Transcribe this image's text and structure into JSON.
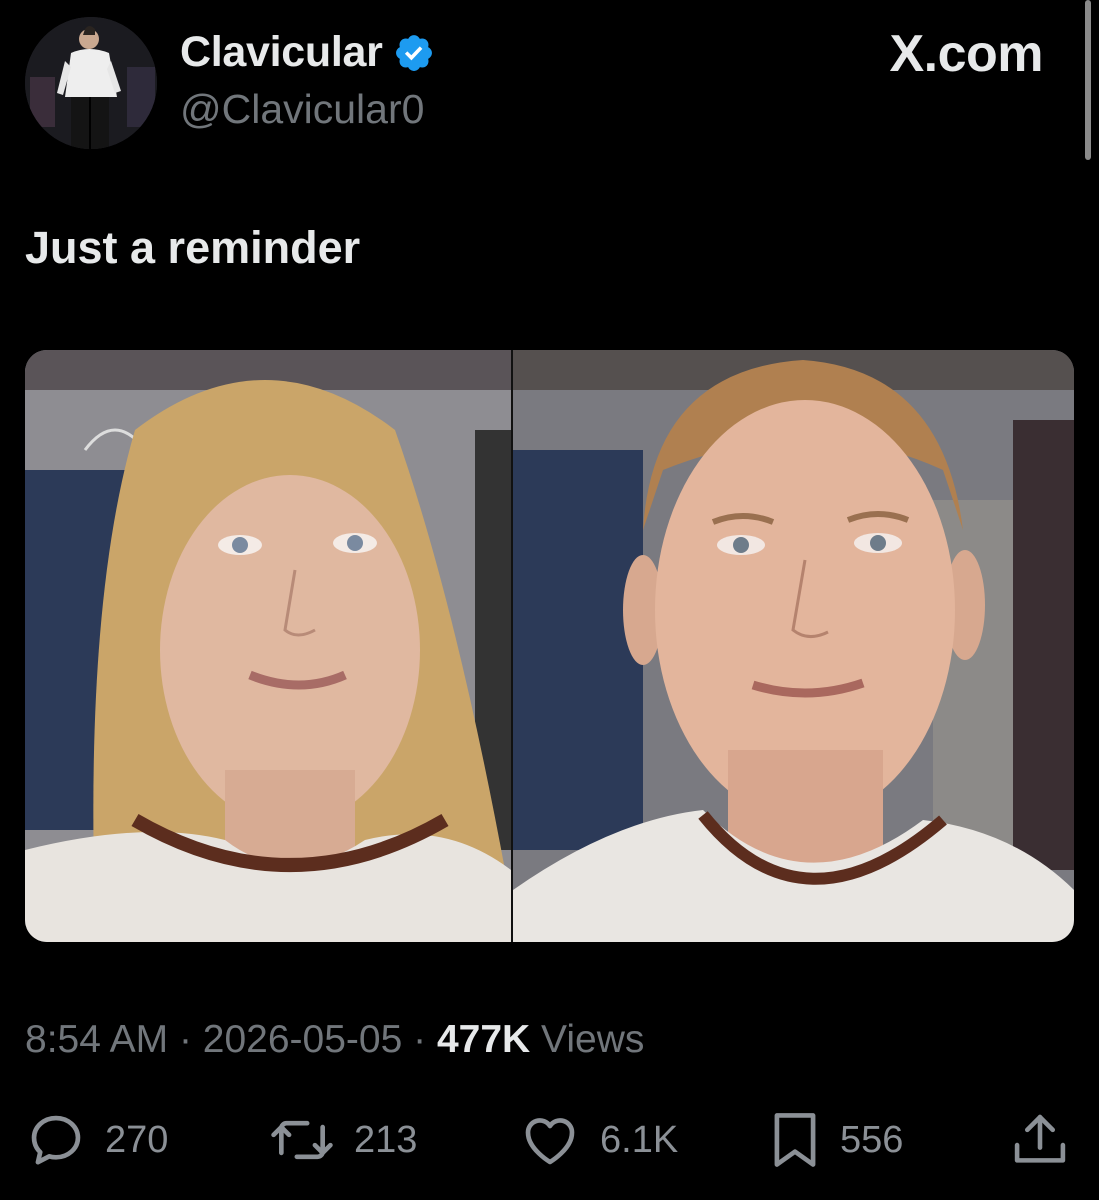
{
  "author": {
    "display_name": "Clavicular",
    "handle": "@Clavicular0",
    "verified": true,
    "verified_color": "#1d9bf0"
  },
  "watermark": "X.com",
  "tweet": {
    "text": "Just a reminder"
  },
  "media": {
    "count": 2
  },
  "meta": {
    "time": "8:54 AM",
    "separator": "·",
    "date": "2026-05-05",
    "views_count": "477K",
    "views_label": "Views"
  },
  "actions": {
    "replies": "270",
    "reposts": "213",
    "likes": "6.1K",
    "bookmarks": "556"
  },
  "icons": [
    "reply-icon",
    "repost-icon",
    "like-icon",
    "bookmark-icon",
    "share-icon",
    "verified-badge-icon"
  ]
}
